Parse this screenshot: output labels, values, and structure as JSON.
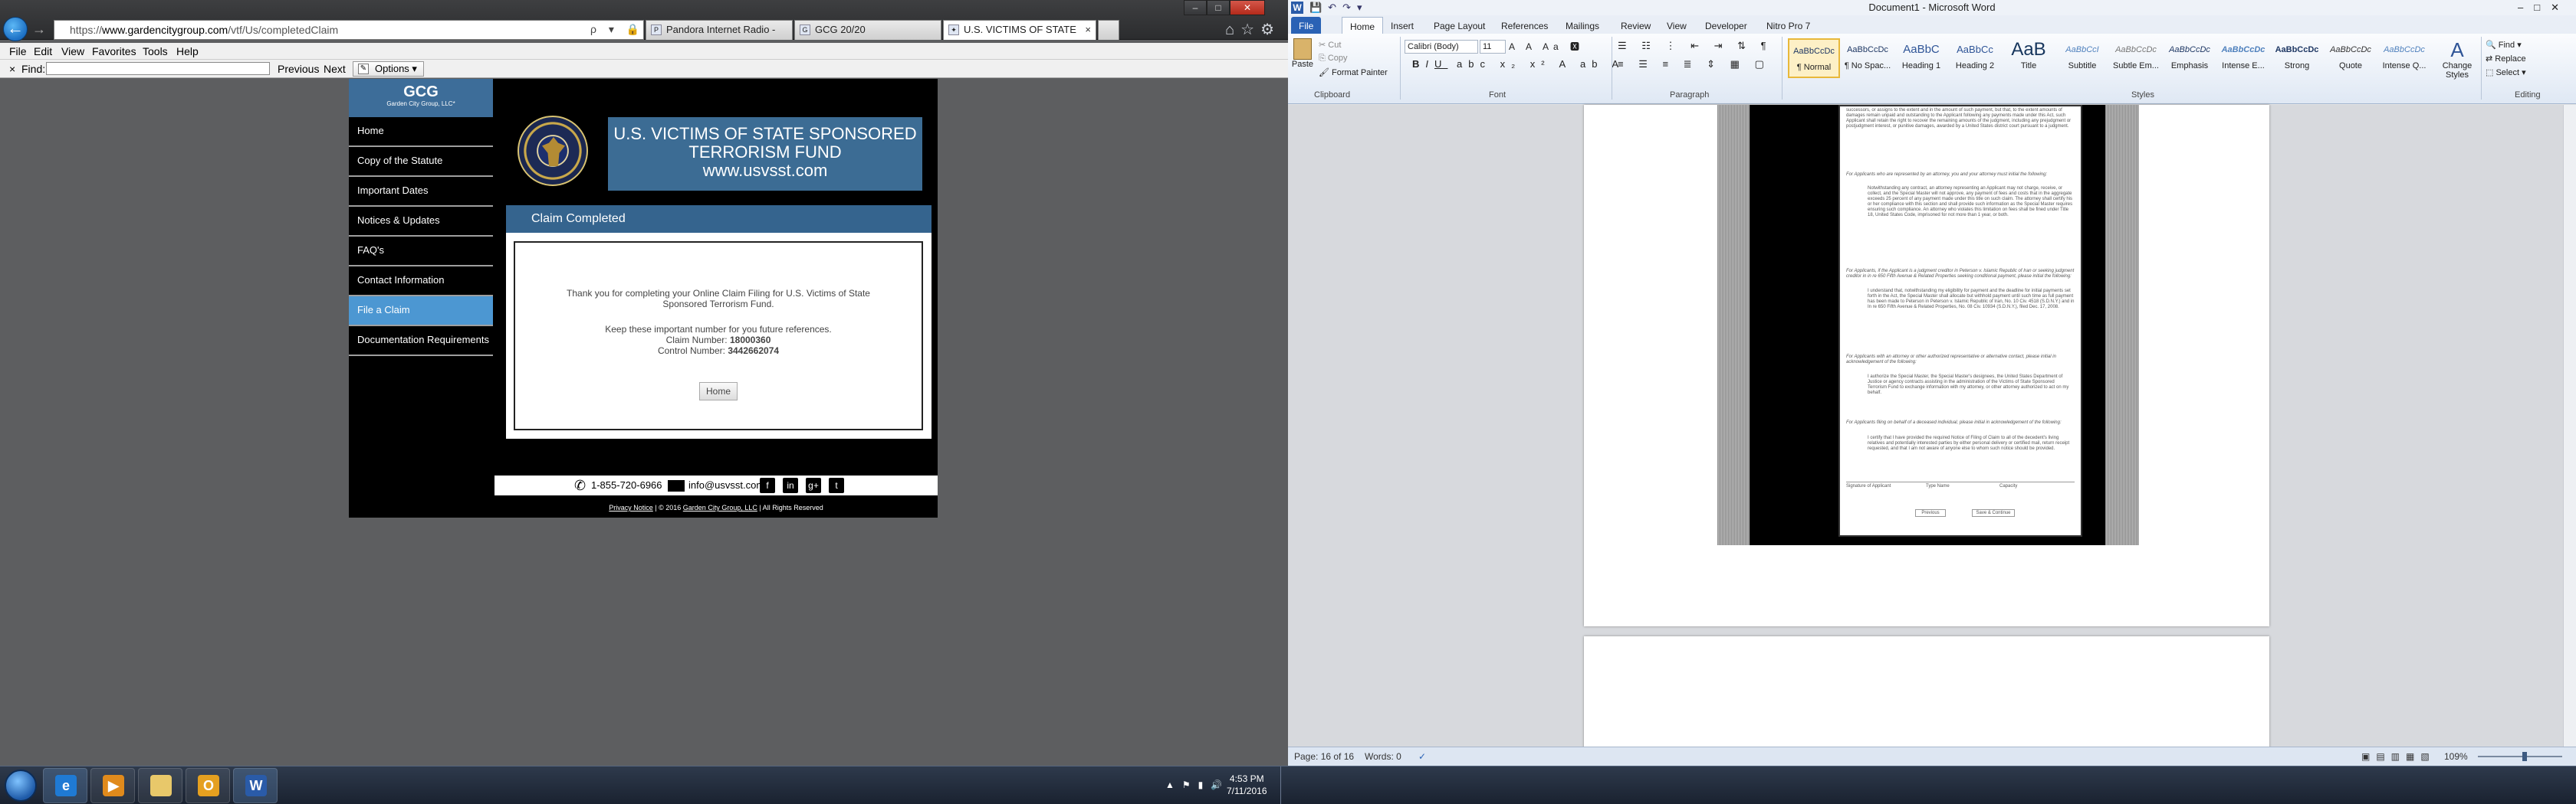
{
  "ie": {
    "url_prefix": "https://",
    "url_domain": "www.gardencitygroup.com",
    "url_path": "/vtf/Us/completedClaim",
    "address_controls": "ρ ▾ 🔒 C ×",
    "tabs": [
      {
        "label": "Pandora Internet Radio - Listen...",
        "icon": "P"
      },
      {
        "label": "GCG 20/20",
        "icon": "G"
      },
      {
        "label": "U.S. VICTIMS OF STATE SP...",
        "icon": "✦"
      }
    ],
    "menu": [
      "File",
      "Edit",
      "View",
      "Favorites",
      "Tools",
      "Help"
    ],
    "find": {
      "close": "×",
      "label": "Find:",
      "previous": "Previous",
      "next": "Next",
      "options": "Options"
    }
  },
  "site": {
    "logo_main": "GCG",
    "logo_sub": "Garden City Group, LLC*",
    "nav": [
      "Home",
      "Copy of the Statute",
      "Important Dates",
      "Notices & Updates",
      "FAQ's",
      "Contact Information",
      "File a Claim",
      "Documentation Requirements"
    ],
    "active_nav": 6,
    "banner_line1": "U.S. VICTIMS OF STATE SPONSORED",
    "banner_line2": "TERRORISM FUND",
    "banner_line3": "www.usvsst.com",
    "claim_header": "Claim Completed",
    "thanks_line1": "Thank you for completing your Online Claim Filing for U.S. Victims of State",
    "thanks_line2": "Sponsored Terrorism Fund.",
    "keep_line": "Keep these important number for you future references.",
    "claim_number_label": "Claim Number:",
    "claim_number": "18000360",
    "control_number_label": "Control Number:",
    "control_number": "3442662074",
    "home_button": "Home",
    "phone": "1-855-720-6966",
    "email": "info@usvsst.com",
    "social": [
      "f",
      "in",
      "g+",
      "t"
    ],
    "footer_link1": "Privacy Notice",
    "footer_mid": " | © 2016 ",
    "footer_link2": "Garden City Group, LLC",
    "footer_end": " | All Rights Reserved"
  },
  "word": {
    "title": "Document1 - Microsoft Word",
    "tabs": [
      "File",
      "Home",
      "Insert",
      "Page Layout",
      "References",
      "Mailings",
      "Review",
      "View",
      "Developer",
      "Nitro Pro 7"
    ],
    "clipboard": {
      "paste": "Paste",
      "cut": "Cut",
      "copy": "Copy",
      "format_painter": "Format Painter",
      "label": "Clipboard"
    },
    "font": {
      "name": "Calibri (Body)",
      "size": "11",
      "label": "Font"
    },
    "paragraph_label": "Paragraph",
    "styles_label": "Styles",
    "styles": [
      {
        "preview": "AaBbCcDc",
        "name": "¶ Normal"
      },
      {
        "preview": "AaBbCcDc",
        "name": "¶ No Spac..."
      },
      {
        "preview": "AaBbC",
        "name": "Heading 1"
      },
      {
        "preview": "AaBbCc",
        "name": "Heading 2"
      },
      {
        "preview": "AaB",
        "name": "Title"
      },
      {
        "preview": "AaBbCcI",
        "name": "Subtitle"
      },
      {
        "preview": "AaBbCcDc",
        "name": "Subtle Em..."
      },
      {
        "preview": "AaBbCcDc",
        "name": "Emphasis"
      },
      {
        "preview": "AaBbCcDc",
        "name": "Intense E..."
      },
      {
        "preview": "AaBbCcDc",
        "name": "Strong"
      },
      {
        "preview": "AaBbCcDc",
        "name": "Quote"
      },
      {
        "preview": "AaBbCcDc",
        "name": "Intense Q..."
      }
    ],
    "change_styles": "Change Styles",
    "editing": {
      "find": "Find",
      "replace": "Replace",
      "select": "Select",
      "label": "Editing"
    },
    "status": {
      "page": "Page: 16 of 16",
      "words": "Words: 0",
      "zoom": "109%"
    },
    "embedded_form": {
      "para1": "successors, or assigns to the extent and in the amount of such payment, but that, to the extent amounts of damages remain unpaid and outstanding to the Applicant following any payments made under this Act, such Applicant shall retain the right to recover the remaining amounts of the judgment, including any prejudgment or postjudgment interest, or punitive damages, awarded by a United States district court pursuant to a judgment.",
      "para2_head": "For Applicants who are represented by an attorney, you and your attorney must initial the following:",
      "para2": "Notwithstanding any contract, an attorney representing an Applicant may not charge, receive, or collect, and the Special Master will not approve, any payment of fees and costs that in the aggregate exceeds 25 percent of any payment made under this title on such claim. The attorney shall certify his or her compliance with this section and shall provide such information as the Special Master requires ensuring such compliance. An attorney who violates this limitation on fees shall be fined under Title 18, United States Code, imprisoned for not more than 1 year, or both.",
      "para3_head": "For Applicants, if the Applicant is a judgment creditor in Peterson v. Islamic Republic of Iran or seeking judgment creditor in in re 650 Fifth Avenue & Related Properties seeking conditional payment, please initial the following:",
      "para3": "I understand that, notwithstanding my eligibility for payment and the deadline for initial payments set forth in the Act, the Special Master shall allocate but withhold payment until such time as full payment has been made to Peterson in Peterson v. Islamic Republic of Iran, No. 10 Civ. 4518 (S.D.N.Y.) and in In re 650 Fifth Avenue & Related Properties, No. 08 Civ. 10934 (S.D.N.Y.), filed Dec. 17, 2008.",
      "para4_head": "For Applicants with an attorney or other authorized representative or alternative contact, please initial in acknowledgement of the following:",
      "para4": "I authorize the Special Master, the Special Master's designees, the United States Department of Justice or agency contracts assisting in the administration of the Victims of State Sponsored Terrorism Fund to exchange information with my attorney, or other attorney authorized to act on my behalf.",
      "para5_head": "For Applicants filing on behalf of a deceased individual, please initial in acknowledgement of the following:",
      "para5": "I certify that I have provided the required Notice of Filing of Claim to all of the decedent's living relatives and potentially interested parties by either personal delivery or certified mail, return receipt requested, and that I am not aware of anyone else to whom such notice should be provided.",
      "sig_labels": [
        "Signature of Applicant",
        "Type Name",
        "Capacity"
      ],
      "buttons": [
        "Previous",
        "Save & Continue"
      ]
    }
  },
  "taskbar": {
    "apps": [
      "Internet Explorer",
      "Media Player",
      "Explorer",
      "Outlook",
      "Word"
    ],
    "time": "4:53 PM",
    "date": "7/11/2016"
  }
}
